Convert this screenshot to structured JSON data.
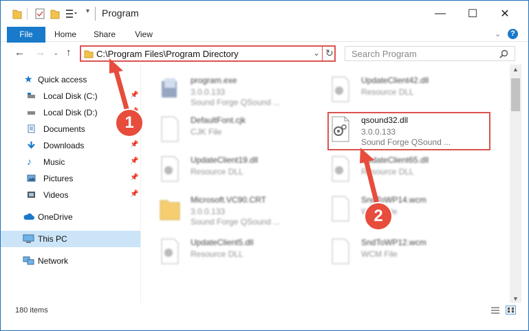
{
  "window": {
    "title": "Program"
  },
  "ribbon": {
    "tabs": [
      "File",
      "Home",
      "Share",
      "View"
    ]
  },
  "address": {
    "path": "C:\\Program Files\\Program Directory"
  },
  "search": {
    "placeholder": "Search Program"
  },
  "sidebar": {
    "items": [
      {
        "label": "Quick access",
        "icon": "star-icon",
        "pinned": false
      },
      {
        "label": "Local Disk (C:)",
        "icon": "drive-icon",
        "pinned": true
      },
      {
        "label": "Local Disk (D:)",
        "icon": "drive-icon",
        "pinned": true
      },
      {
        "label": "Documents",
        "icon": "documents-icon",
        "pinned": true
      },
      {
        "label": "Downloads",
        "icon": "download-icon",
        "pinned": true
      },
      {
        "label": "Music",
        "icon": "music-icon",
        "pinned": true
      },
      {
        "label": "Pictures",
        "icon": "pictures-icon",
        "pinned": true
      },
      {
        "label": "Videos",
        "icon": "videos-icon",
        "pinned": true
      },
      {
        "label": "OneDrive",
        "icon": "cloud-icon",
        "pinned": false
      },
      {
        "label": "This PC",
        "icon": "computer-icon",
        "pinned": false
      },
      {
        "label": "Network",
        "icon": "network-icon",
        "pinned": false
      }
    ]
  },
  "files": [
    {
      "name": "program.exe",
      "line1": "3.0.0.133",
      "line2": "Sound Forge QSound ...",
      "icon": "exe-icon"
    },
    {
      "name": "UpdateClient42.dll",
      "line1": "Resource DLL",
      "line2": "",
      "icon": "dll-icon"
    },
    {
      "name": "DefaultFont.cjk",
      "line1": "CJK File",
      "line2": "",
      "icon": "file-icon"
    },
    {
      "name": "qsound32.dll",
      "line1": "3.0.0.133",
      "line2": "Sound Forge QSound ...",
      "icon": "dll-icon"
    },
    {
      "name": "UpdateClient19.dll",
      "line1": "Resource DLL",
      "line2": "",
      "icon": "dll-icon"
    },
    {
      "name": "UpdateClient65.dll",
      "line1": "Resource DLL",
      "line2": "",
      "icon": "dll-icon"
    },
    {
      "name": "Microsoft.VC90.CRT",
      "line1": "3.0.0.133",
      "line2": "Sound Forge QSound ...",
      "icon": "folder-icon"
    },
    {
      "name": "SndToWP14.wcm",
      "line1": "WCM File",
      "line2": "",
      "icon": "file-icon"
    },
    {
      "name": "UpdateClient5.dll",
      "line1": "Resource DLL",
      "line2": "",
      "icon": "dll-icon"
    },
    {
      "name": "SndToWP12.wcm",
      "line1": "WCM File",
      "line2": "",
      "icon": "file-icon"
    }
  ],
  "status": {
    "count": "180 items"
  },
  "callouts": [
    "1",
    "2"
  ],
  "colors": {
    "accent": "#1979ca",
    "highlight": "#d9534f",
    "selected": "#cce4f7"
  }
}
